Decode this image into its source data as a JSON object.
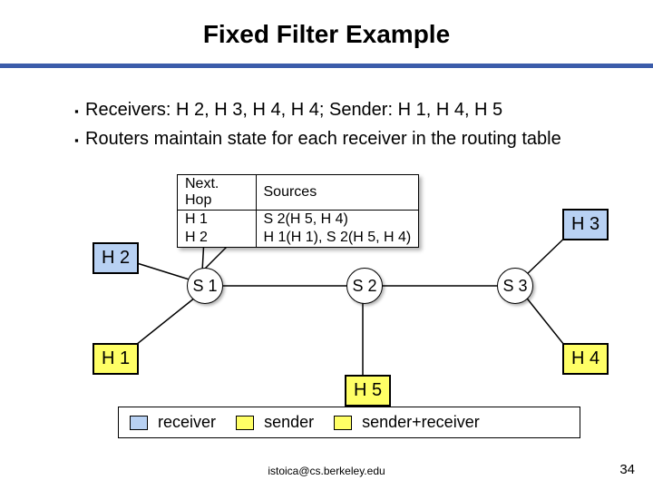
{
  "title": "Fixed Filter Example",
  "bullets": [
    "Receivers: H 2, H 3, H 4, H 4; Sender: H 1, H 4, H 5",
    "Routers maintain state for each receiver in the routing table"
  ],
  "table": {
    "header": {
      "nexthop": "Next. Hop",
      "sources": "Sources"
    },
    "rows": [
      {
        "nexthop": "H 1",
        "sources": "S 2(H 5, H 4)"
      },
      {
        "nexthop": "H 2",
        "sources": "H 1(H 1), S 2(H 5, H 4)"
      }
    ]
  },
  "hosts": {
    "h1": "H 1",
    "h2": "H 2",
    "h3": "H 3",
    "h4": "H 4",
    "h5": "H 5"
  },
  "routers": {
    "s1": "S 1",
    "s2": "S 2",
    "s3": "S 3"
  },
  "legend": {
    "receiver": "receiver",
    "sender": "sender",
    "both": "sender+receiver"
  },
  "footer": {
    "email": "istoica@cs.berkeley.edu",
    "page": "34"
  },
  "colors": {
    "receiver": "#b8d1f3",
    "sender": "#ffff66",
    "both": "#ffff66",
    "rule": "#3b5caa"
  }
}
